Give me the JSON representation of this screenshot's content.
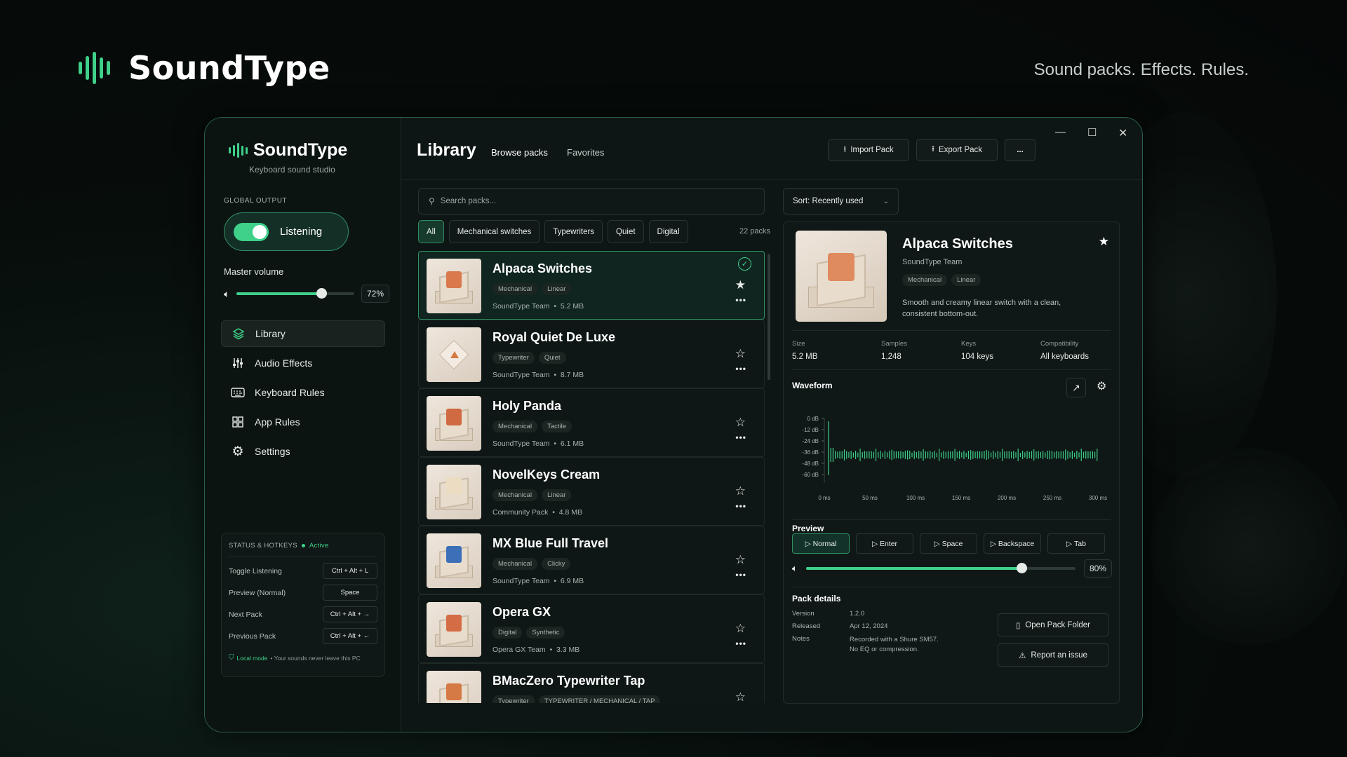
{
  "brand": {
    "title": "SoundType",
    "tagline": "Sound packs. Effects. Rules."
  },
  "sidebar": {
    "app_name": "SoundType",
    "app_sub": "Keyboard sound studio",
    "global_output_label": "GLOBAL OUTPUT",
    "toggle_label": "Listening",
    "toggle_on": true,
    "volume_label": "Master volume",
    "volume_value": 72,
    "volume_text": "72%",
    "nav": [
      {
        "label": "Library",
        "icon": "layers-icon",
        "active": true
      },
      {
        "label": "Audio Effects",
        "icon": "sliders-icon",
        "active": false
      },
      {
        "label": "Keyboard Rules",
        "icon": "keyboard-icon",
        "active": false
      },
      {
        "label": "App Rules",
        "icon": "grid-icon",
        "active": false
      },
      {
        "label": "Settings",
        "icon": "gear-icon",
        "active": false
      }
    ],
    "status": {
      "title": "STATUS & HOTKEYS",
      "state": "Active",
      "hotkeys": [
        {
          "label": "Toggle Listening",
          "key": "Ctrl + Alt + L"
        },
        {
          "label": "Preview (Normal)",
          "key": "Space"
        },
        {
          "label": "Next Pack",
          "key": "Ctrl + Alt + →"
        },
        {
          "label": "Previous Pack",
          "key": "Ctrl + Alt + ←"
        }
      ],
      "local_label": "Local mode",
      "local_text": "• Your sounds never leave this PC"
    }
  },
  "header": {
    "title": "Library",
    "tabs": [
      "Browse packs",
      "Favorites"
    ],
    "import_label": "Import Pack",
    "export_label": "Export Pack",
    "more_label": "..."
  },
  "search": {
    "placeholder": "Search packs..."
  },
  "sort": {
    "label": "Sort: Recently used"
  },
  "filters": [
    "All",
    "Mechanical switches",
    "Typewriters",
    "Quiet",
    "Digital"
  ],
  "pack_count": "22 packs",
  "packs": [
    {
      "name": "Alpaca Switches",
      "tags": [
        "Mechanical",
        "Linear"
      ],
      "author": "SoundType Team",
      "size": "5.2 MB",
      "selected": true,
      "cap": "#d9794c"
    },
    {
      "name": "Royal Quiet De Luxe",
      "tags": [
        "Typewriter",
        "Quiet"
      ],
      "author": "SoundType Team",
      "size": "8.7 MB",
      "selected": false,
      "cap": "diamond"
    },
    {
      "name": "Holy Panda",
      "tags": [
        "Mechanical",
        "Tactile"
      ],
      "author": "SoundType Team",
      "size": "6.1 MB",
      "selected": false,
      "cap": "#d06a42"
    },
    {
      "name": "NovelKeys Cream",
      "tags": [
        "Mechanical",
        "Linear"
      ],
      "author": "Community Pack",
      "size": "4.8 MB",
      "selected": false,
      "cap": "#ecdcc2"
    },
    {
      "name": "MX Blue Full Travel",
      "tags": [
        "Mechanical",
        "Clicky"
      ],
      "author": "SoundType Team",
      "size": "6.9 MB",
      "selected": false,
      "cap": "#3b6fb8"
    },
    {
      "name": "Opera GX",
      "tags": [
        "Digital",
        "Synthetic"
      ],
      "author": "Opera GX Team",
      "size": "3.3 MB",
      "selected": false,
      "cap": "#d46d45"
    },
    {
      "name": "BMacZero Typewriter Tap",
      "tags": [
        "Typewriter",
        "TYPEWRITER / MECHANICAL / TAP"
      ],
      "author": "",
      "size": "",
      "selected": false,
      "cap": "#d67a45"
    }
  ],
  "detail": {
    "name": "Alpaca Switches",
    "author": "SoundType Team",
    "tags": [
      "Mechanical",
      "Linear"
    ],
    "description": "Smooth and creamy linear switch with a clean, consistent bottom-out.",
    "stats": [
      {
        "k": "Size",
        "v": "5.2 MB"
      },
      {
        "k": "Samples",
        "v": "1,248"
      },
      {
        "k": "Keys",
        "v": "104 keys"
      },
      {
        "k": "Compatibility",
        "v": "All keyboards"
      }
    ],
    "waveform_title": "Waveform",
    "db_labels": [
      "0 dB",
      "-12 dB",
      "-24 dB",
      "-36 dB",
      "-48 dB",
      "-60 dB"
    ],
    "time_labels": [
      "0 ms",
      "50 ms",
      "100 ms",
      "150 ms",
      "200 ms",
      "250 ms",
      "300 ms"
    ],
    "preview_title": "Preview",
    "preview_buttons": [
      "Normal",
      "Enter",
      "Space",
      "Backspace",
      "Tab"
    ],
    "preview_volume": 80,
    "preview_volume_text": "80%",
    "pack_details_title": "Pack details",
    "pack_details": [
      {
        "k": "Version",
        "v": "1.2.0"
      },
      {
        "k": "Released",
        "v": "Apr 12, 2024"
      },
      {
        "k": "Notes",
        "v": "Recorded with a Shure SM57. No EQ or compression."
      }
    ],
    "open_folder_label": "Open Pack Folder",
    "report_label": "Report an issue"
  },
  "colors": {
    "accent": "#3fd08a",
    "border_accent": "#2f8e63",
    "bg": "#0d1614"
  }
}
